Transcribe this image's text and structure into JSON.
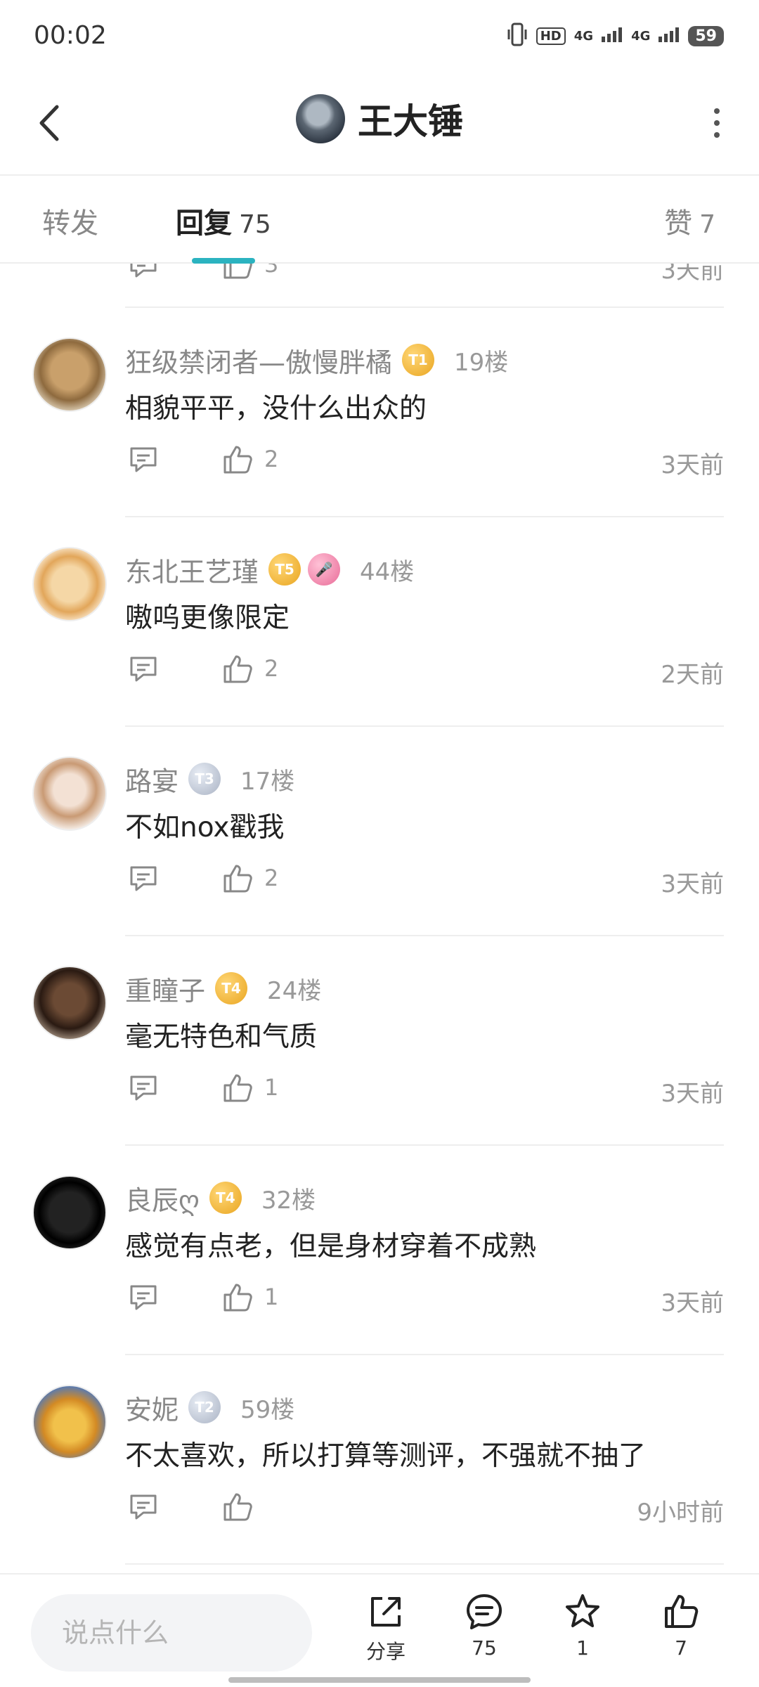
{
  "status": {
    "time": "00:02",
    "hd": "HD",
    "net1": "4G",
    "net2": "4G",
    "battery": "59"
  },
  "header": {
    "title": "王大锤"
  },
  "tabs": {
    "forward": "转发",
    "reply": "回复",
    "reply_count": "75",
    "like": "赞",
    "like_count": "7"
  },
  "partial_row": {
    "like_count": "3",
    "time": "3天前"
  },
  "comments": [
    {
      "name": "狂级禁闭者—傲慢胖橘",
      "badges": [
        "T1"
      ],
      "floor": "19楼",
      "text": "相貌平平，没什么出众的",
      "likes": "2",
      "time": "3天前"
    },
    {
      "name": "东北王艺瑾",
      "badges": [
        "T5",
        "mic"
      ],
      "floor": "44楼",
      "text": "嗷呜更像限定",
      "likes": "2",
      "time": "2天前"
    },
    {
      "name": "路宴",
      "badges": [
        "T3"
      ],
      "floor": "17楼",
      "text": "不如nox戳我",
      "likes": "2",
      "time": "3天前"
    },
    {
      "name": "重瞳子",
      "badges": [
        "T4"
      ],
      "floor": "24楼",
      "text": "毫无特色和气质",
      "likes": "1",
      "time": "3天前"
    },
    {
      "name": "良辰ღ",
      "badges": [
        "T4"
      ],
      "floor": "32楼",
      "text": "感觉有点老，但是身材穿着不成熟",
      "likes": "1",
      "time": "3天前"
    },
    {
      "name": "安妮",
      "badges": [
        "T2"
      ],
      "floor": "59楼",
      "text": "不太喜欢，所以打算等测评，不强就不抽了",
      "likes": "",
      "time": "9小时前"
    }
  ],
  "bottom": {
    "input_placeholder": "说点什么",
    "share_label": "分享",
    "comment_count": "75",
    "star_count": "1",
    "like_count": "7"
  },
  "colors": {
    "accent": "#2bb3c0",
    "badge_gold": "#e9a520",
    "badge_silver": "#aab3c4"
  }
}
